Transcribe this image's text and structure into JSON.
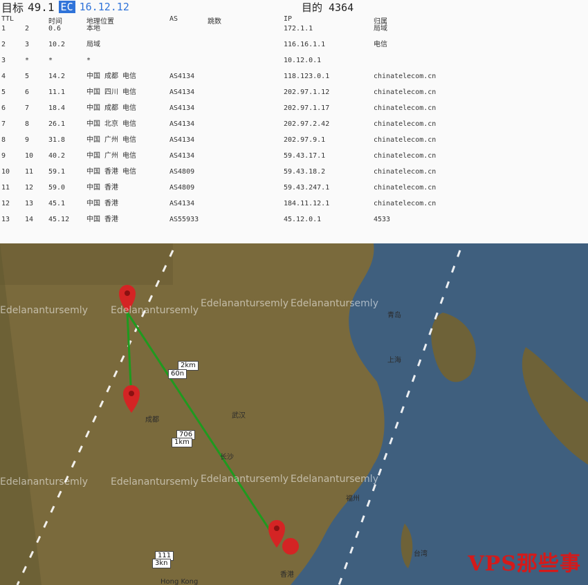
{
  "header": {
    "title": "目标",
    "ip_partial": "49.1",
    "ip_highlight": "16.12.12",
    "host_label": "目的 4364"
  },
  "columns": [
    "TTL",
    "时间",
    "地理位置",
    "AS",
    "跳数",
    "IP",
    "归属"
  ],
  "trace_rows": [
    [
      "1",
      "2",
      "0.6",
      "本地",
      "",
      "172.1.1",
      "局域"
    ],
    [
      "2",
      "3",
      "10.2",
      "局域",
      "",
      "116.16.1.1",
      "电信"
    ],
    [
      "3",
      "*",
      "*",
      "*",
      "",
      "10.12.0.1",
      ""
    ],
    [
      "4",
      "5",
      "14.2",
      "中国 成都 电信",
      "AS4134",
      "118.123.0.1",
      "chinatelecom.cn"
    ],
    [
      "5",
      "6",
      "11.1",
      "中国 四川 电信",
      "AS4134",
      "202.97.1.12",
      "chinatelecom.cn"
    ],
    [
      "6",
      "7",
      "18.4",
      "中国 成都 电信",
      "AS4134",
      "202.97.1.17",
      "chinatelecom.cn"
    ],
    [
      "7",
      "8",
      "26.1",
      "中国 北京 电信",
      "AS4134",
      "202.97.2.42",
      "chinatelecom.cn"
    ],
    [
      "8",
      "9",
      "31.8",
      "中国 广州 电信",
      "AS4134",
      "202.97.9.1",
      "chinatelecom.cn"
    ],
    [
      "9",
      "10",
      "40.2",
      "中国 广州 电信",
      "AS4134",
      "59.43.17.1",
      "chinatelecom.cn"
    ],
    [
      "10",
      "11",
      "59.1",
      "中国 香港 电信",
      "AS4809",
      "59.43.18.2",
      "chinatelecom.cn"
    ],
    [
      "11",
      "12",
      "59.0",
      "中国 香港",
      "AS4809",
      "59.43.247.1",
      "chinatelecom.cn"
    ],
    [
      "12",
      "13",
      "45.1",
      "中国 香港",
      "AS4134",
      "184.11.12.1",
      "chinatelecom.cn"
    ],
    [
      "13",
      "14",
      "45.12",
      "中国 香港",
      "AS55933",
      "45.12.0.1",
      "4533"
    ]
  ],
  "map": {
    "watermark_text": "Edelanantursemly",
    "labels": {
      "segment_1": "2km",
      "segment_1_sub": "60n",
      "segment_2": "706",
      "segment_2_sub": "1km",
      "segment_3": "111",
      "segment_3_sub": "3kn"
    },
    "places": {
      "p1": "成都",
      "p2": "武汉",
      "p3": "长沙",
      "p4": "上海",
      "p5": "福州",
      "p6": "香港",
      "p7": "青岛",
      "p8": "台湾",
      "p9": "Hong Kong"
    },
    "colors": {
      "sea": "#3f5f7e",
      "land": "#7a6a3c",
      "route": "#1f9a1f",
      "pin": "#d42424"
    }
  },
  "brand": "VPS那些事"
}
